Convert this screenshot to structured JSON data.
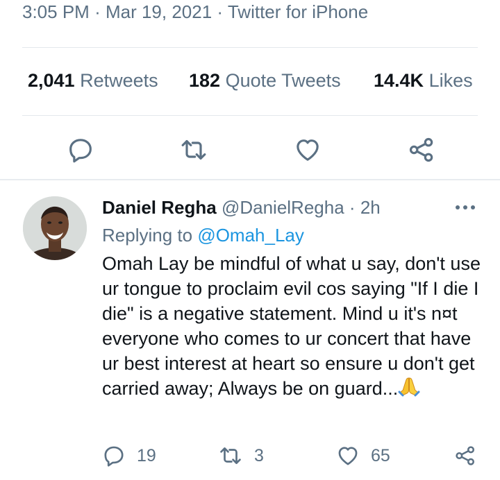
{
  "tweet_meta": {
    "time": "3:05 PM",
    "sep1": "·",
    "date": "Mar 19, 2021",
    "sep2": "·",
    "source": "Twitter for iPhone"
  },
  "stats": {
    "retweets_count": "2,041",
    "retweets_label": "Retweets",
    "quotes_count": "182",
    "quotes_label": "Quote Tweets",
    "likes_count": "14.4K",
    "likes_label": "Likes"
  },
  "reply_tweet": {
    "display_name": "Daniel Regha",
    "handle": "@DanielRegha",
    "sep": "·",
    "age": "2h",
    "replying_prefix": "Replying to",
    "replying_handle": "@Omah_Lay",
    "text": "Omah Lay be mindful of what u say, don't use ur tongue to proclaim evil cos saying \"If I die I die\" is a negative statement. Mind u it's n¤t everyone who comes to ur concert that have ur best interest at heart so ensure u don't get carried away; Always be on guard...",
    "emoji_icon": "folded-hands-icon",
    "reply_count": "19",
    "retweet_count": "3",
    "like_count": "65"
  },
  "icons": {
    "reply": "reply-icon",
    "retweet": "retweet-icon",
    "like": "heart-icon",
    "share": "share-icon",
    "more": "more-icon"
  },
  "colors": {
    "secondary_text": "#5b7083",
    "link": "#1b95e0",
    "primary_text": "#0f1419"
  }
}
